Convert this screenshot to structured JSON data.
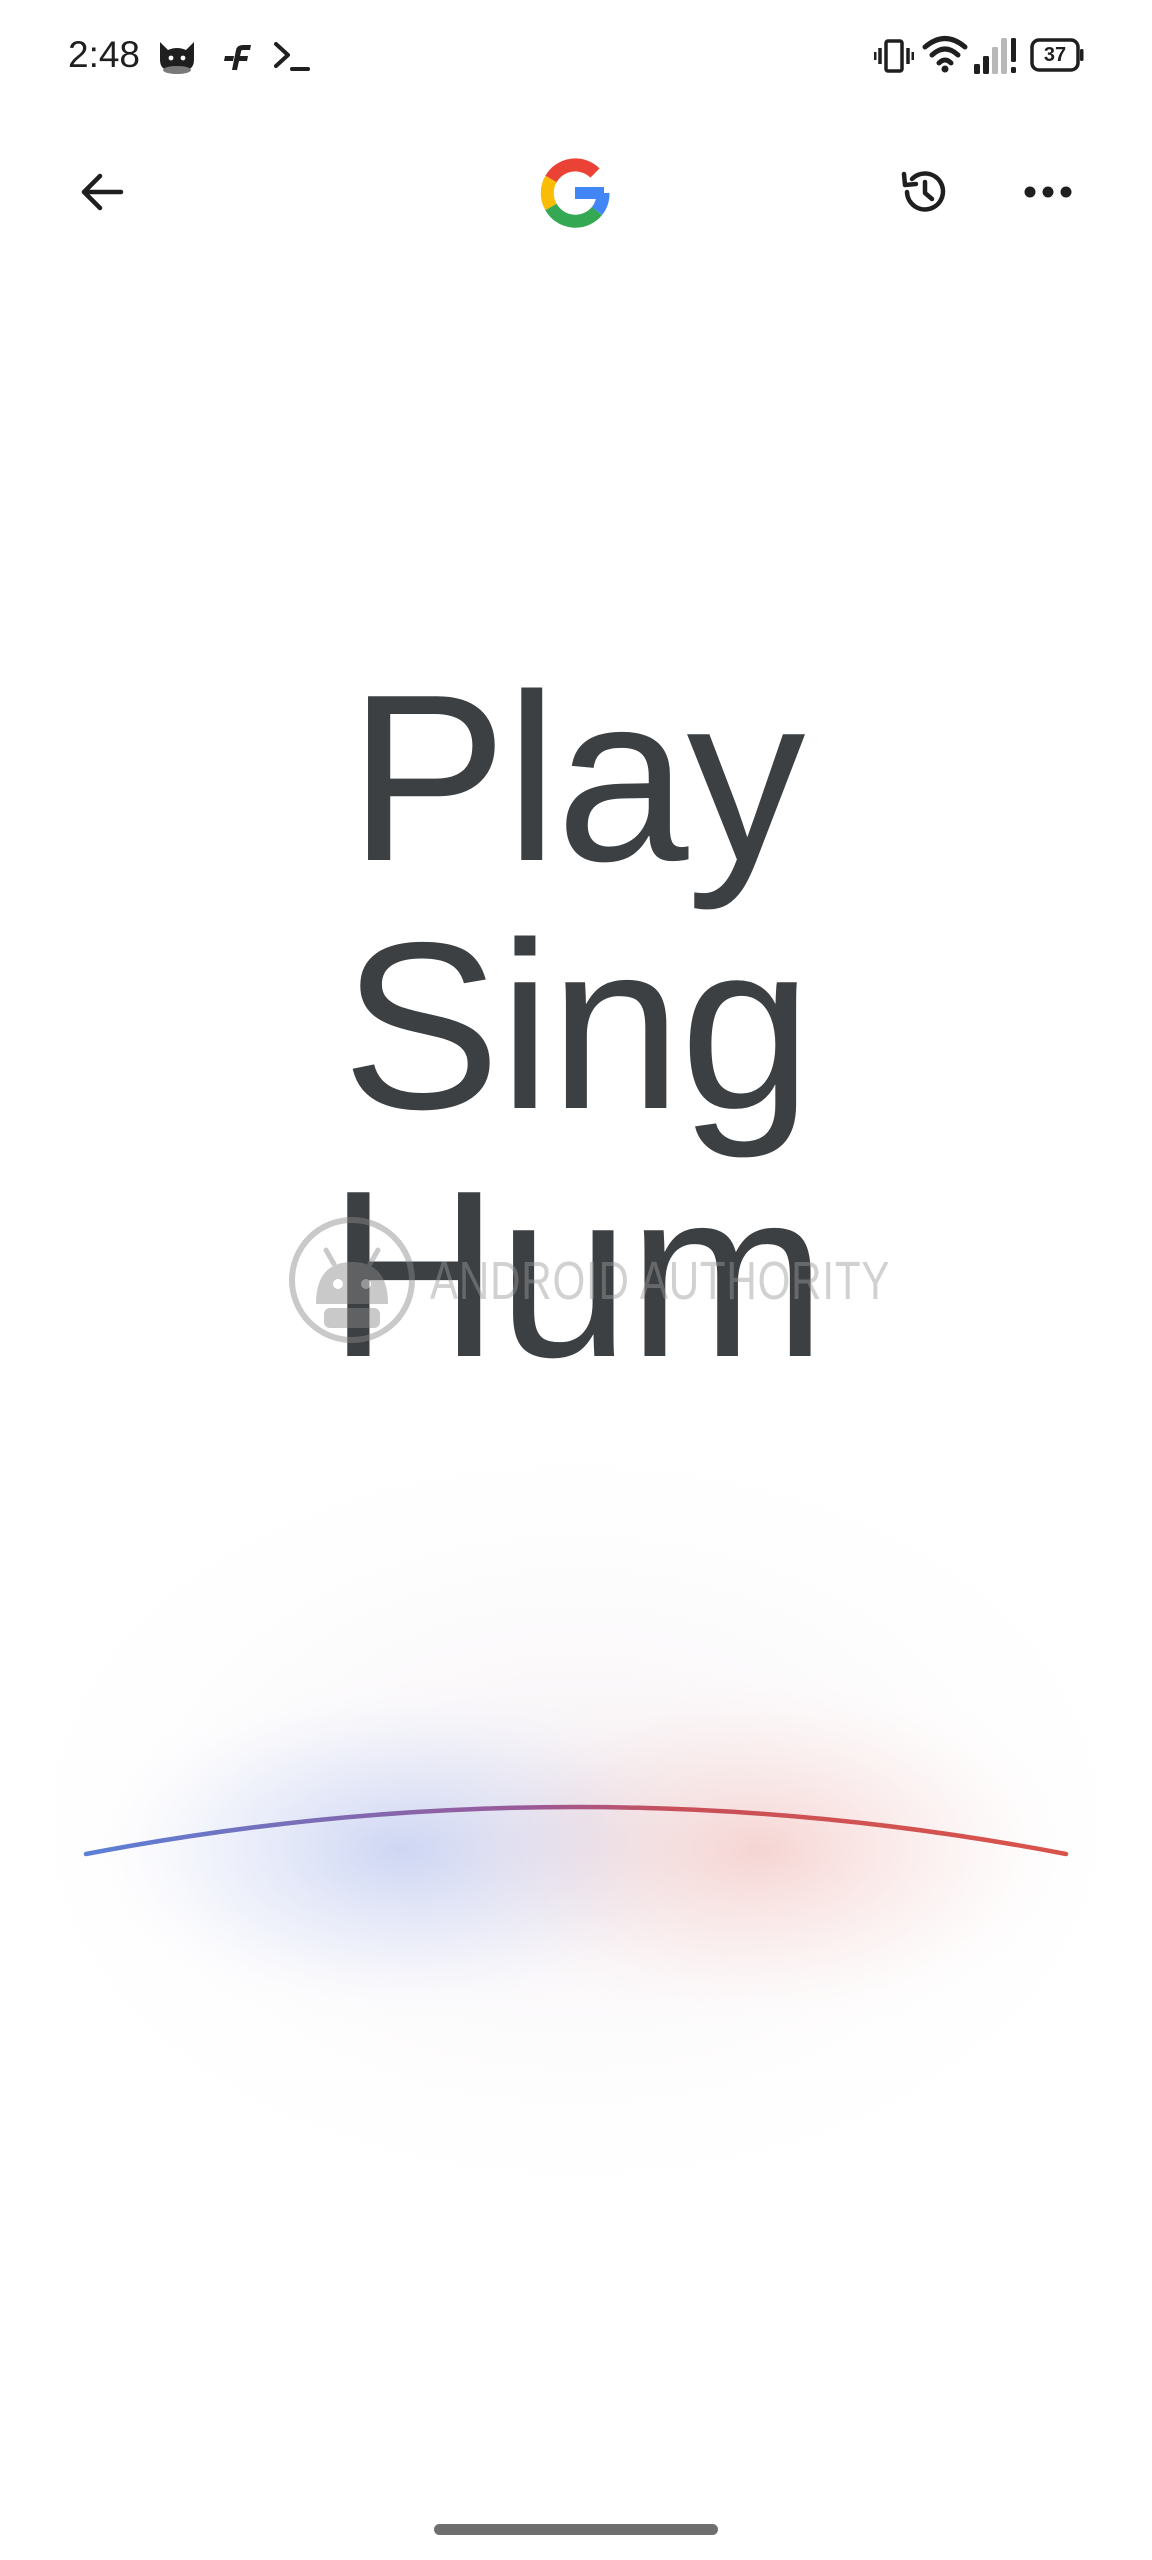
{
  "status_bar": {
    "time": "2:48",
    "battery_level": "37",
    "icons": [
      "cat-app-icon",
      "f-app-icon",
      "terminal-icon",
      "vibrate-icon",
      "wifi-icon",
      "signal-icon",
      "battery-icon"
    ]
  },
  "app_bar": {
    "back_icon": "arrow-left-icon",
    "logo": "google-g-logo",
    "history_icon": "history-icon",
    "more_icon": "more-horizontal-icon"
  },
  "prompt": {
    "line1": "Play",
    "line2": "Sing",
    "line3": "Hum"
  },
  "watermark": {
    "text": "ANDROID AUTHORITY"
  },
  "colors": {
    "text": "#3c4043",
    "google_blue": "#4285F4",
    "google_red": "#EA4335",
    "google_yellow": "#FBBC05",
    "google_green": "#34A853",
    "arc_blue": "#5b7fd6",
    "arc_red": "#d9534a"
  }
}
